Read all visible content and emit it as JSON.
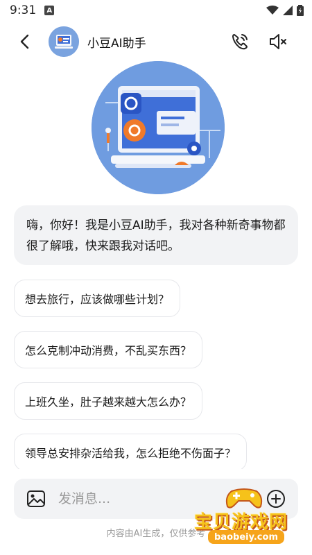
{
  "status_bar": {
    "time": "9:31",
    "notification_badge": "A"
  },
  "header": {
    "title": "小豆AI助手",
    "back_icon": "chevron-left-icon",
    "call_icon": "phone-call-icon",
    "mute_icon": "speaker-mute-icon"
  },
  "chat": {
    "greeting": "嗨，你好！我是小豆AI助手，我对各种新奇事物都很了解哦，快来跟我对话吧。",
    "suggestions": [
      "想去旅行，应该做哪些计划？",
      "怎么克制冲动消费，不乱买东西？",
      "上班久坐，肚子越来越大怎么办？",
      "领导总安排杂活给我，怎么拒绝不伤面子？"
    ]
  },
  "input": {
    "placeholder": "发消息...",
    "image_icon": "image-icon",
    "plus_icon": "plus-circle-icon"
  },
  "footer": {
    "disclaimer": "内容由AI生成，仅供参考"
  },
  "watermark": {
    "text": "宝贝游戏网",
    "domain": "baobeiy.com"
  },
  "colors": {
    "accent_blue": "#6f9ce0",
    "bubble_bg": "#f2f3f5",
    "watermark_yellow": "#f6c21a"
  }
}
